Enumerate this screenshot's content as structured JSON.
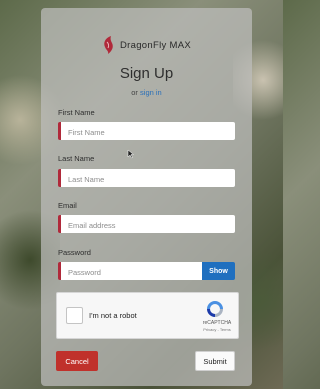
{
  "brand": {
    "name": "DragonFly MAX",
    "logo_icon": "dragonfly-logo-icon",
    "accent": "#b0293a"
  },
  "form": {
    "title": "Sign Up",
    "signin_prefix": "or",
    "signin_link": "sign in",
    "fields": {
      "first_name": {
        "label": "First Name",
        "placeholder": "First Name",
        "value": ""
      },
      "last_name": {
        "label": "Last Name",
        "placeholder": "Last Name",
        "value": ""
      },
      "email": {
        "label": "Email",
        "placeholder": "Email address",
        "value": ""
      },
      "password": {
        "label": "Password",
        "placeholder": "Password",
        "value": "",
        "show_label": "Show"
      }
    },
    "captcha": {
      "label": "I'm not a robot",
      "brand": "reCAPTCHA",
      "links": "Privacy - Terms",
      "checked": false
    },
    "cancel_label": "Cancel",
    "submit_label": "Submit"
  },
  "colors": {
    "primary_blue": "#1f6fbf",
    "cancel_red": "#c0312b",
    "link": "#2a6fb8"
  }
}
